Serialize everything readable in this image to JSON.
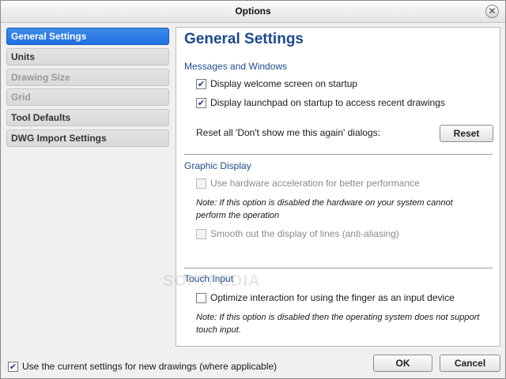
{
  "window": {
    "title": "Options",
    "close_glyph": "✕"
  },
  "sidebar": {
    "items": [
      {
        "label": "General Settings",
        "state": "active"
      },
      {
        "label": "Units",
        "state": "normal"
      },
      {
        "label": "Drawing Size",
        "state": "disabled"
      },
      {
        "label": "Grid",
        "state": "disabled"
      },
      {
        "label": "Tool Defaults",
        "state": "normal"
      },
      {
        "label": "DWG Import Settings",
        "state": "normal"
      }
    ]
  },
  "panel": {
    "title": "General Settings",
    "messages": {
      "heading": "Messages and Windows",
      "welcome_label": "Display welcome screen on startup",
      "welcome_checked": true,
      "launchpad_label": "Display launchpad on startup to access recent drawings",
      "launchpad_checked": true,
      "reset_label": "Reset all 'Don't show me this again' dialogs:",
      "reset_button": "Reset"
    },
    "graphic": {
      "heading": "Graphic Display",
      "hw_label": "Use hardware acceleration for better performance",
      "hw_checked": false,
      "hw_note": "Note: If this option is disabled the hardware on your system cannot perform the operation",
      "aa_label": "Smooth out the display of lines (anti-aliasing)",
      "aa_checked": false
    },
    "touch": {
      "heading": "Touch Input",
      "finger_label": "Optimize interaction for using the finger as an input device",
      "finger_checked": false,
      "note": "Note: If this option is disabled then the operating system does not support touch input."
    }
  },
  "footer": {
    "current_settings_label": "Use the current settings for new drawings (where applicable)",
    "current_settings_checked": true,
    "ok_label": "OK",
    "cancel_label": "Cancel"
  },
  "watermark": "SOFTPEDIA",
  "colors": {
    "accent": "#2a78e4",
    "heading": "#1b4a8a"
  },
  "check_glyph": "✔"
}
